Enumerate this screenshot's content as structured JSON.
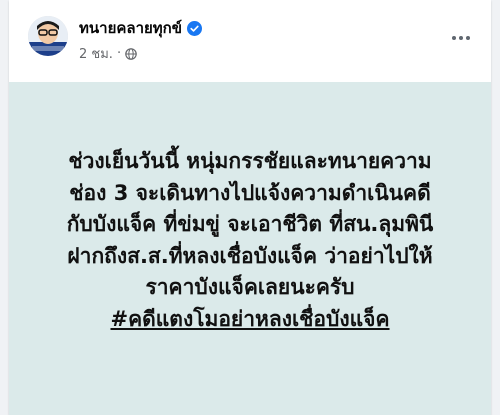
{
  "post": {
    "author": "ทนายคลายทุกข์",
    "time": "2 ชม.",
    "separator": "·",
    "privacy_icon": "globe-icon",
    "verified_icon": "verified-badge-icon",
    "more_icon": "more-options-icon"
  },
  "body": {
    "lines": [
      "ช่วงเย็นวันนี้ หนุ่มกรรชัยและทนายความ",
      "ช่อง 3 จะเดินทางไปแจ้งความดำเนินคดี",
      "กับบังแจ็ค ที่ข่มขู่ จะเอาชีวิต ที่สน.ลุมพินี",
      "ฝากถึงส.ส.ที่หลงเชื่อบังแจ็ค ว่าอย่าไปให้",
      "ราคาบังแจ็คเลยนะครับ"
    ],
    "hashtag": "#คดีแตงโมอย่าหลงเชื่อบังแจ็ค"
  },
  "colors": {
    "background": "#dbeaea",
    "verified_blue": "#1877f2",
    "meta_gray": "#65676b"
  }
}
